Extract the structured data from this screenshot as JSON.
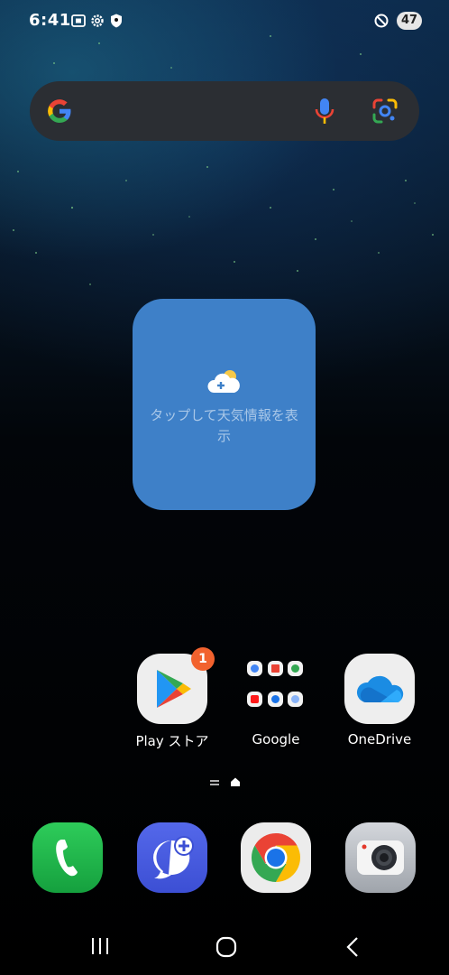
{
  "status_bar": {
    "time": "6:41",
    "left_icons": [
      "screenshot-icon",
      "settings-icon",
      "shield-icon"
    ],
    "right_icons": [
      "do-not-disturb-icon"
    ],
    "battery": "47"
  },
  "search_bar": {
    "logo": "google-logo-icon",
    "mic": "microphone-icon",
    "lens": "google-lens-icon"
  },
  "weather_widget": {
    "icon": "add-weather-cloud-icon",
    "text": "タップして天気情報を表示",
    "bg_color": "#3e80c8"
  },
  "apps": [
    {
      "label": "Play ストア",
      "icon": "play-store-icon",
      "badge": "1"
    },
    {
      "label": "Google",
      "icon": "google-folder-icon"
    },
    {
      "label": "OneDrive",
      "icon": "onedrive-icon"
    }
  ],
  "page_indicator": {
    "icons": [
      "menu-lines-icon",
      "home-dot-icon"
    ]
  },
  "dock": [
    {
      "icon": "phone-icon",
      "color": "#1fb34a"
    },
    {
      "icon": "messages-icon",
      "color": "#4a5be0"
    },
    {
      "icon": "chrome-icon",
      "color": "#ececec"
    },
    {
      "icon": "camera-icon",
      "color": "#bfc3c9"
    }
  ],
  "nav_bar": {
    "icons": [
      "recents-icon",
      "home-icon",
      "back-icon"
    ]
  }
}
